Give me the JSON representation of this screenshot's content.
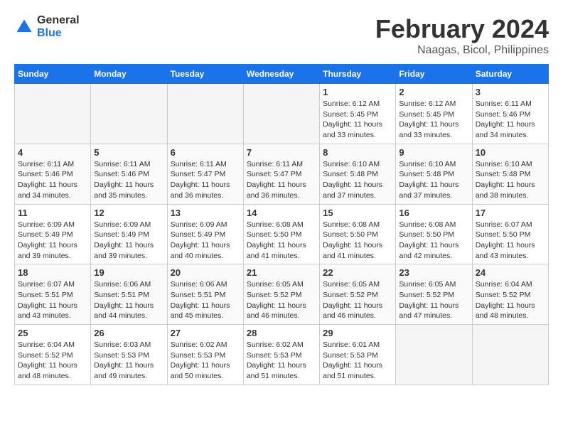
{
  "header": {
    "logo_general": "General",
    "logo_blue": "Blue",
    "month_year": "February 2024",
    "location": "Naagas, Bicol, Philippines"
  },
  "weekdays": [
    "Sunday",
    "Monday",
    "Tuesday",
    "Wednesday",
    "Thursday",
    "Friday",
    "Saturday"
  ],
  "weeks": [
    [
      {
        "day": "",
        "info": ""
      },
      {
        "day": "",
        "info": ""
      },
      {
        "day": "",
        "info": ""
      },
      {
        "day": "",
        "info": ""
      },
      {
        "day": "1",
        "info": "Sunrise: 6:12 AM\nSunset: 5:45 PM\nDaylight: 11 hours and 33 minutes."
      },
      {
        "day": "2",
        "info": "Sunrise: 6:12 AM\nSunset: 5:45 PM\nDaylight: 11 hours and 33 minutes."
      },
      {
        "day": "3",
        "info": "Sunrise: 6:11 AM\nSunset: 5:46 PM\nDaylight: 11 hours and 34 minutes."
      }
    ],
    [
      {
        "day": "4",
        "info": "Sunrise: 6:11 AM\nSunset: 5:46 PM\nDaylight: 11 hours and 34 minutes."
      },
      {
        "day": "5",
        "info": "Sunrise: 6:11 AM\nSunset: 5:46 PM\nDaylight: 11 hours and 35 minutes."
      },
      {
        "day": "6",
        "info": "Sunrise: 6:11 AM\nSunset: 5:47 PM\nDaylight: 11 hours and 36 minutes."
      },
      {
        "day": "7",
        "info": "Sunrise: 6:11 AM\nSunset: 5:47 PM\nDaylight: 11 hours and 36 minutes."
      },
      {
        "day": "8",
        "info": "Sunrise: 6:10 AM\nSunset: 5:48 PM\nDaylight: 11 hours and 37 minutes."
      },
      {
        "day": "9",
        "info": "Sunrise: 6:10 AM\nSunset: 5:48 PM\nDaylight: 11 hours and 37 minutes."
      },
      {
        "day": "10",
        "info": "Sunrise: 6:10 AM\nSunset: 5:48 PM\nDaylight: 11 hours and 38 minutes."
      }
    ],
    [
      {
        "day": "11",
        "info": "Sunrise: 6:09 AM\nSunset: 5:49 PM\nDaylight: 11 hours and 39 minutes."
      },
      {
        "day": "12",
        "info": "Sunrise: 6:09 AM\nSunset: 5:49 PM\nDaylight: 11 hours and 39 minutes."
      },
      {
        "day": "13",
        "info": "Sunrise: 6:09 AM\nSunset: 5:49 PM\nDaylight: 11 hours and 40 minutes."
      },
      {
        "day": "14",
        "info": "Sunrise: 6:08 AM\nSunset: 5:50 PM\nDaylight: 11 hours and 41 minutes."
      },
      {
        "day": "15",
        "info": "Sunrise: 6:08 AM\nSunset: 5:50 PM\nDaylight: 11 hours and 41 minutes."
      },
      {
        "day": "16",
        "info": "Sunrise: 6:08 AM\nSunset: 5:50 PM\nDaylight: 11 hours and 42 minutes."
      },
      {
        "day": "17",
        "info": "Sunrise: 6:07 AM\nSunset: 5:50 PM\nDaylight: 11 hours and 43 minutes."
      }
    ],
    [
      {
        "day": "18",
        "info": "Sunrise: 6:07 AM\nSunset: 5:51 PM\nDaylight: 11 hours and 43 minutes."
      },
      {
        "day": "19",
        "info": "Sunrise: 6:06 AM\nSunset: 5:51 PM\nDaylight: 11 hours and 44 minutes."
      },
      {
        "day": "20",
        "info": "Sunrise: 6:06 AM\nSunset: 5:51 PM\nDaylight: 11 hours and 45 minutes."
      },
      {
        "day": "21",
        "info": "Sunrise: 6:05 AM\nSunset: 5:52 PM\nDaylight: 11 hours and 46 minutes."
      },
      {
        "day": "22",
        "info": "Sunrise: 6:05 AM\nSunset: 5:52 PM\nDaylight: 11 hours and 46 minutes."
      },
      {
        "day": "23",
        "info": "Sunrise: 6:05 AM\nSunset: 5:52 PM\nDaylight: 11 hours and 47 minutes."
      },
      {
        "day": "24",
        "info": "Sunrise: 6:04 AM\nSunset: 5:52 PM\nDaylight: 11 hours and 48 minutes."
      }
    ],
    [
      {
        "day": "25",
        "info": "Sunrise: 6:04 AM\nSunset: 5:52 PM\nDaylight: 11 hours and 48 minutes."
      },
      {
        "day": "26",
        "info": "Sunrise: 6:03 AM\nSunset: 5:53 PM\nDaylight: 11 hours and 49 minutes."
      },
      {
        "day": "27",
        "info": "Sunrise: 6:02 AM\nSunset: 5:53 PM\nDaylight: 11 hours and 50 minutes."
      },
      {
        "day": "28",
        "info": "Sunrise: 6:02 AM\nSunset: 5:53 PM\nDaylight: 11 hours and 51 minutes."
      },
      {
        "day": "29",
        "info": "Sunrise: 6:01 AM\nSunset: 5:53 PM\nDaylight: 11 hours and 51 minutes."
      },
      {
        "day": "",
        "info": ""
      },
      {
        "day": "",
        "info": ""
      }
    ]
  ]
}
